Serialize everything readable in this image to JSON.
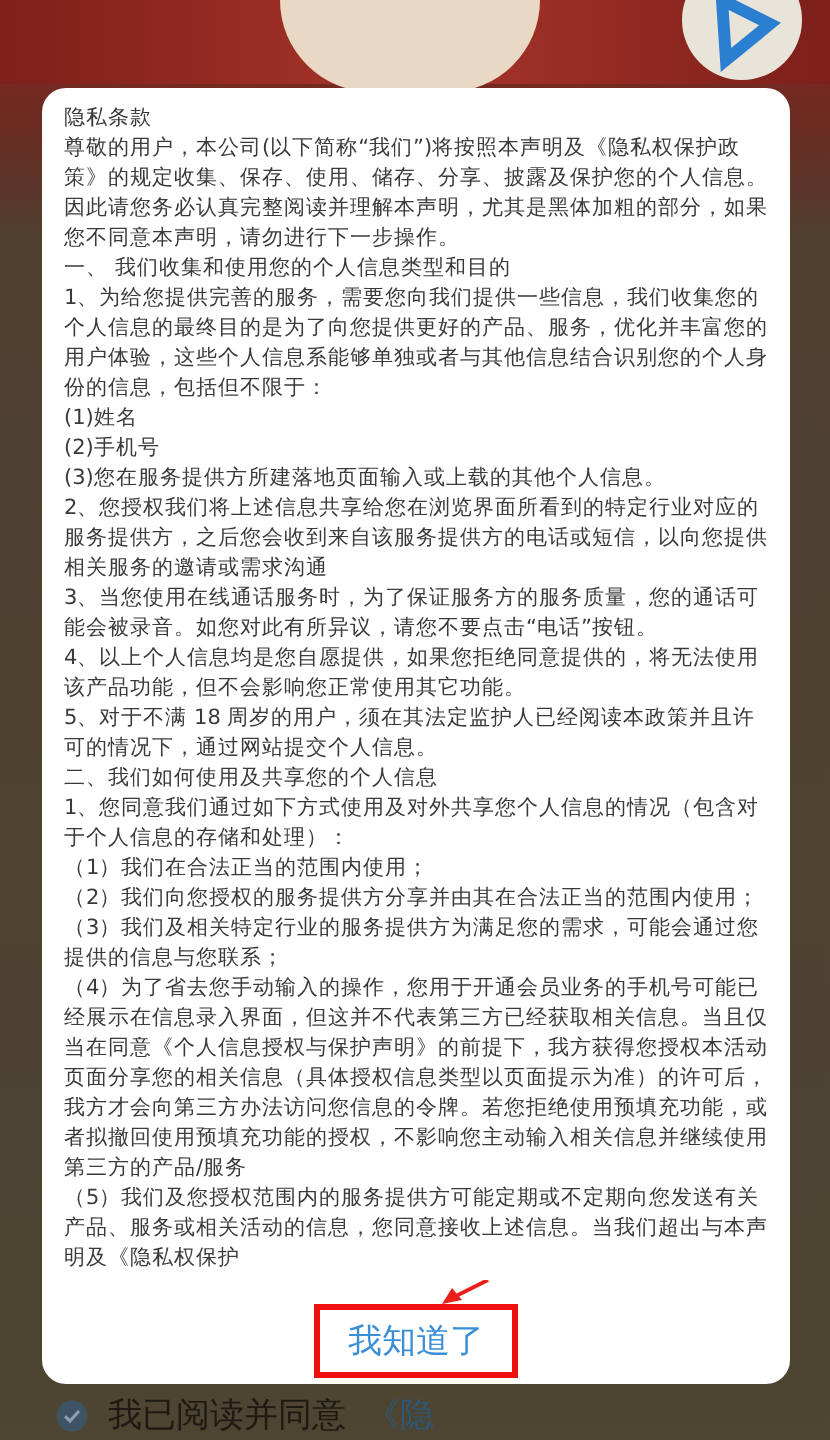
{
  "dialog": {
    "title": "隐私条款",
    "paragraphs": [
      "尊敬的用户，本公司(以下简称“我们”)将按照本声明及《隐私权保护政策》的规定收集、保存、使用、储存、分享、披露及保护您的个人信息。因此请您务必认真完整阅读并理解本声明，尤其是黑体加粗的部分，如果您不同意本声明，请勿进行下一步操作。",
      "一、 我们收集和使用您的个人信息类型和目的",
      "1、为给您提供完善的服务，需要您向我们提供一些信息，我们收集您的个人信息的最终目的是为了向您提供更好的产品、服务，优化并丰富您的用户体验，这些个人信息系能够单独或者与其他信息结合识别您的个人身份的信息，包括但不限于：",
      "(1)姓名",
      "(2)手机号",
      "(3)您在服务提供方所建落地页面输入或上载的其他个人信息。",
      "2、您授权我们将上述信息共享给您在浏览界面所看到的特定行业对应的服务提供方，之后您会收到来自该服务提供方的电话或短信，以向您提供相关服务的邀请或需求沟通",
      "3、当您使用在线通话服务时，为了保证服务方的服务质量，您的通话可能会被录音。如您对此有所异议，请您不要点击“电话”按钮。",
      "4、以上个人信息均是您自愿提供，如果您拒绝同意提供的，将无法使用该产品功能，但不会影响您正常使用其它功能。",
      "5、对于不满 18 周岁的用户，须在其法定监护人已经阅读本政策并且许可的情况下，通过网站提交个人信息。",
      "二、我们如何使用及共享您的个人信息",
      "1、您同意我们通过如下方式使用及对外共享您个人信息的情况（包含对于个人信息的存储和处理）：",
      "（1）我们在合法正当的范围内使用；",
      "（2）我们向您授权的服务提供方分享并由其在合法正当的范围内使用；",
      "（3）我们及相关特定行业的服务提供方为满足您的需求，可能会通过您提供的信息与您联系；",
      "（4）为了省去您手动输入的操作，您用于开通会员业务的手机号可能已经展示在信息录入界面，但这并不代表第三方已经获取相关信息。当且仅当在同意《个人信息授权与保护声明》的前提下，我方获得您授权本活动页面分享您的相关信息（具体授权信息类型以页面提示为准）的许可后，我方才会向第三方办法访问您信息的令牌。若您拒绝使用预填充功能，或者拟撤回使用预填充功能的授权，不影响您主动输入相关信息并继续使用第三方的产品/服务",
      "（5）我们及您授权范围内的服务提供方可能定期或不定期向您发送有关产品、服务或相关活动的信息，您同意接收上述信息。当我们超出与本声明及《隐私权保护"
    ],
    "confirm_button": "我知道了"
  },
  "agreement": {
    "checked": true,
    "text": "我已阅读并同意",
    "link": "《隐"
  }
}
